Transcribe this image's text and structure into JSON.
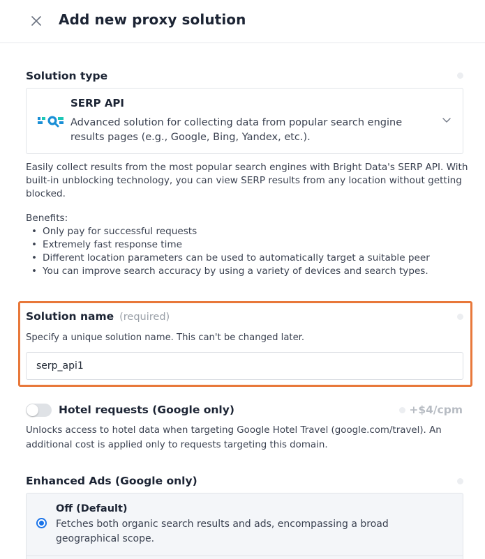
{
  "header": {
    "title": "Add new proxy solution",
    "close_icon": "close-icon"
  },
  "solution_type": {
    "label": "Solution type",
    "selected": {
      "name": "SERP API",
      "description": "Advanced solution for collecting data from popular search engine results pages (e.g., Google, Bing, Yandex, etc.).",
      "icon": "serp-search-icon"
    },
    "chevron_icon": "chevron-down-icon"
  },
  "intro": "Easily collect results from the most popular search engines with Bright Data's SERP API. With built-in unblocking technology, you can view SERP results from any location without getting blocked.",
  "benefits": {
    "heading": "Benefits:",
    "items": [
      "Only pay for successful requests",
      "Extremely fast response time",
      "Different location parameters can be used to automatically target a suitable peer",
      "You can improve search accuracy by using a variety of devices and search types."
    ]
  },
  "solution_name": {
    "label": "Solution name",
    "required": "(required)",
    "hint": "Specify a unique solution name. This can't be changed later.",
    "value": "serp_api1"
  },
  "hotel": {
    "label": "Hotel requests (Google only)",
    "price": "+$4/cpm",
    "enabled": false,
    "description": "Unlocks access to hotel data when targeting Google Hotel Travel (google.com/travel). An additional cost is applied only to requests targeting this domain."
  },
  "enhanced_ads": {
    "label": "Enhanced Ads (Google only)",
    "options": [
      {
        "title": "Off (Default)",
        "description": "Fetches both organic search results and ads, encompassing a broad geographical scope.",
        "selected": true
      }
    ]
  },
  "colors": {
    "highlight_border": "#e8783a",
    "radio_accent": "#1a73e8",
    "icon_blue": "#1a8fd6",
    "icon_teal": "#1cc7b6"
  }
}
